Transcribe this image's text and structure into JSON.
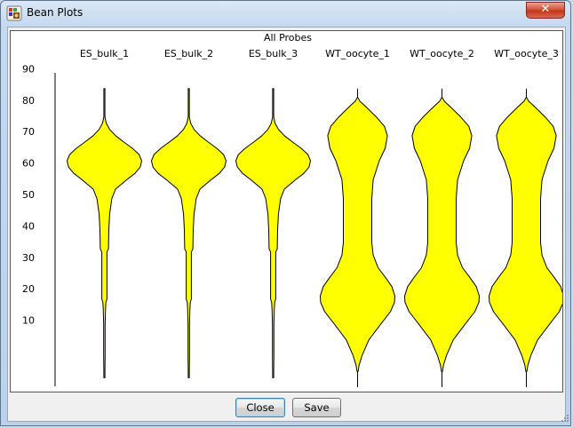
{
  "window": {
    "title": "Bean Plots",
    "app_icon": "seqmonk-app-icon",
    "close_glyph": "✕"
  },
  "chart_data": {
    "type": "violin",
    "title": "All Probes",
    "ylim": [
      0,
      100
    ],
    "yticks": [
      10,
      20,
      30,
      40,
      50,
      60,
      70,
      80,
      90
    ],
    "fill_color": "#ffff00",
    "outline_color": "#000000",
    "grid": false,
    "series": [
      {
        "name": "ES_bulk_1",
        "range": [
          3,
          95
        ],
        "density": [
          [
            3,
            0.0
          ],
          [
            5,
            0.01
          ],
          [
            10,
            0.02
          ],
          [
            15,
            0.02
          ],
          [
            20,
            0.02
          ],
          [
            25,
            0.03
          ],
          [
            27,
            0.04
          ],
          [
            28,
            0.07
          ],
          [
            35,
            0.07
          ],
          [
            43,
            0.07
          ],
          [
            44,
            0.11
          ],
          [
            50,
            0.12
          ],
          [
            55,
            0.14
          ],
          [
            60,
            0.2
          ],
          [
            63,
            0.3
          ],
          [
            66,
            0.6
          ],
          [
            68,
            0.82
          ],
          [
            70,
            0.96
          ],
          [
            72,
            1.0
          ],
          [
            74,
            0.93
          ],
          [
            76,
            0.75
          ],
          [
            78,
            0.52
          ],
          [
            80,
            0.3
          ],
          [
            82,
            0.14
          ],
          [
            84,
            0.05
          ],
          [
            86,
            0.01
          ],
          [
            88,
            0.0
          ],
          [
            95,
            0.0
          ]
        ]
      },
      {
        "name": "ES_bulk_2",
        "range": [
          3,
          95
        ],
        "density": [
          [
            3,
            0.0
          ],
          [
            5,
            0.01
          ],
          [
            10,
            0.02
          ],
          [
            15,
            0.02
          ],
          [
            20,
            0.02
          ],
          [
            25,
            0.03
          ],
          [
            27,
            0.04
          ],
          [
            28,
            0.07
          ],
          [
            35,
            0.07
          ],
          [
            43,
            0.07
          ],
          [
            44,
            0.11
          ],
          [
            50,
            0.12
          ],
          [
            55,
            0.14
          ],
          [
            60,
            0.2
          ],
          [
            63,
            0.3
          ],
          [
            66,
            0.6
          ],
          [
            68,
            0.82
          ],
          [
            70,
            0.96
          ],
          [
            72,
            1.0
          ],
          [
            74,
            0.93
          ],
          [
            76,
            0.75
          ],
          [
            78,
            0.52
          ],
          [
            80,
            0.3
          ],
          [
            82,
            0.14
          ],
          [
            84,
            0.05
          ],
          [
            86,
            0.01
          ],
          [
            88,
            0.0
          ],
          [
            95,
            0.0
          ]
        ]
      },
      {
        "name": "ES_bulk_3",
        "range": [
          3,
          95
        ],
        "density": [
          [
            3,
            0.0
          ],
          [
            5,
            0.01
          ],
          [
            10,
            0.02
          ],
          [
            15,
            0.02
          ],
          [
            20,
            0.02
          ],
          [
            25,
            0.03
          ],
          [
            27,
            0.04
          ],
          [
            28,
            0.07
          ],
          [
            35,
            0.07
          ],
          [
            43,
            0.07
          ],
          [
            44,
            0.11
          ],
          [
            50,
            0.12
          ],
          [
            55,
            0.14
          ],
          [
            60,
            0.2
          ],
          [
            63,
            0.3
          ],
          [
            66,
            0.6
          ],
          [
            68,
            0.82
          ],
          [
            70,
            0.96
          ],
          [
            72,
            1.0
          ],
          [
            74,
            0.93
          ],
          [
            76,
            0.75
          ],
          [
            78,
            0.52
          ],
          [
            80,
            0.3
          ],
          [
            82,
            0.14
          ],
          [
            84,
            0.05
          ],
          [
            86,
            0.01
          ],
          [
            88,
            0.0
          ],
          [
            95,
            0.0
          ]
        ]
      },
      {
        "name": "WT_oocyte_1",
        "range": [
          0,
          95
        ],
        "density": [
          [
            5,
            0.0
          ],
          [
            7,
            0.04
          ],
          [
            10,
            0.12
          ],
          [
            15,
            0.3
          ],
          [
            20,
            0.62
          ],
          [
            24,
            0.88
          ],
          [
            27,
            0.99
          ],
          [
            29,
            1.0
          ],
          [
            32,
            0.92
          ],
          [
            35,
            0.74
          ],
          [
            38,
            0.55
          ],
          [
            42,
            0.42
          ],
          [
            46,
            0.38
          ],
          [
            60,
            0.38
          ],
          [
            66,
            0.42
          ],
          [
            72,
            0.58
          ],
          [
            76,
            0.74
          ],
          [
            80,
            0.8
          ],
          [
            83,
            0.72
          ],
          [
            86,
            0.5
          ],
          [
            89,
            0.24
          ],
          [
            91,
            0.06
          ],
          [
            92,
            0.0
          ]
        ]
      },
      {
        "name": "WT_oocyte_2",
        "range": [
          0,
          95
        ],
        "density": [
          [
            5,
            0.0
          ],
          [
            7,
            0.04
          ],
          [
            10,
            0.12
          ],
          [
            15,
            0.3
          ],
          [
            20,
            0.62
          ],
          [
            24,
            0.88
          ],
          [
            27,
            0.99
          ],
          [
            29,
            1.0
          ],
          [
            32,
            0.92
          ],
          [
            35,
            0.74
          ],
          [
            38,
            0.55
          ],
          [
            42,
            0.42
          ],
          [
            46,
            0.38
          ],
          [
            60,
            0.38
          ],
          [
            66,
            0.42
          ],
          [
            72,
            0.58
          ],
          [
            76,
            0.74
          ],
          [
            80,
            0.8
          ],
          [
            83,
            0.72
          ],
          [
            86,
            0.5
          ],
          [
            89,
            0.24
          ],
          [
            91,
            0.06
          ],
          [
            92,
            0.0
          ]
        ]
      },
      {
        "name": "WT_oocyte_3",
        "range": [
          0,
          95
        ],
        "density": [
          [
            5,
            0.0
          ],
          [
            7,
            0.04
          ],
          [
            10,
            0.12
          ],
          [
            15,
            0.3
          ],
          [
            20,
            0.62
          ],
          [
            24,
            0.88
          ],
          [
            27,
            0.99
          ],
          [
            29,
            1.0
          ],
          [
            32,
            0.92
          ],
          [
            35,
            0.74
          ],
          [
            38,
            0.55
          ],
          [
            42,
            0.42
          ],
          [
            46,
            0.38
          ],
          [
            60,
            0.38
          ],
          [
            66,
            0.42
          ],
          [
            72,
            0.58
          ],
          [
            76,
            0.74
          ],
          [
            80,
            0.8
          ],
          [
            83,
            0.72
          ],
          [
            86,
            0.5
          ],
          [
            89,
            0.24
          ],
          [
            91,
            0.06
          ],
          [
            92,
            0.0
          ]
        ]
      }
    ]
  },
  "buttons": {
    "close_label": "Close",
    "save_label": "Save"
  }
}
